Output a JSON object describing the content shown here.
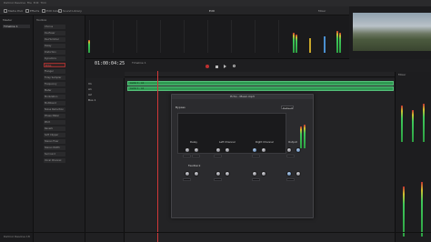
{
  "window": {
    "title": "Edit",
    "app_name": "DaVinci Resolve 18"
  },
  "menu": [
    "DaVinci Resolve",
    "File",
    "Edit",
    "Trim",
    "Timeline",
    "Clip",
    "Mark",
    "View",
    "Playback",
    "Fusion",
    "Color",
    "Fairlight",
    "Workspace",
    "Help"
  ],
  "toolbar": {
    "left": [
      "Media Pool",
      "Effects",
      "Edit Index",
      "Sound Library"
    ],
    "center_title": "Edit",
    "right": [
      "Mixer",
      "Metadata",
      "Inspector"
    ]
  },
  "mediapool": {
    "header": "Master",
    "items": [
      "Timeline 1"
    ]
  },
  "effects": {
    "header": "Toolbox",
    "items": [
      "Toolbox",
      "Video Transitions",
      "Audio Transitions",
      "Titles",
      "Generators",
      "Effects",
      "Open FX",
      "Filters",
      "Audio FX",
      "Fairlight FX",
      "Favorites"
    ],
    "fairlight_list": [
      "Chorus",
      "De-Esser",
      "De-Hummer",
      "Delay",
      "Distortion",
      "Dynamics",
      "Echo",
      "Flanger",
      "Foley Sampler",
      "Frequency Analyzer",
      "Meter",
      "Modulation",
      "Multiband Compressor",
      "Noise Reduction",
      "Phase Meter",
      "Pitch",
      "Reverb",
      "Soft Clipper",
      "Stereo Fixer",
      "Stereo Width",
      "Surround Analyzer",
      "Vocal Channel"
    ],
    "selected": "Echo"
  },
  "timeline": {
    "timecode": "01:00:04:25",
    "name": "Timeline 1",
    "tracks": [
      {
        "id": "V1",
        "clip": "Audio 1 - A1"
      },
      {
        "id": "A1",
        "clip": "Audio 1 - A1"
      },
      {
        "id": "A2",
        "clip": ""
      }
    ],
    "bus": "Bus 1"
  },
  "plugin": {
    "title": "Echo - Music.mp3",
    "preset_label": "Default",
    "bypass": "Bypass",
    "sections": [
      {
        "name": "Delay",
        "labels": [
          "Left",
          "Right",
          "Feedback"
        ]
      },
      {
        "name": "Left Channel",
        "labels": [
          "Delay",
          "Lo Cut",
          "Hi Cut"
        ]
      },
      {
        "name": "Right Channel",
        "labels": [
          "Delay",
          "Lo Cut",
          "Hi Cut"
        ]
      },
      {
        "name": "Output",
        "labels": [
          "Dry",
          "Wet",
          "Level"
        ]
      }
    ]
  },
  "mixer": {
    "title": "Mixer",
    "channels": [
      "A1",
      "A2",
      "Bus 1"
    ]
  }
}
